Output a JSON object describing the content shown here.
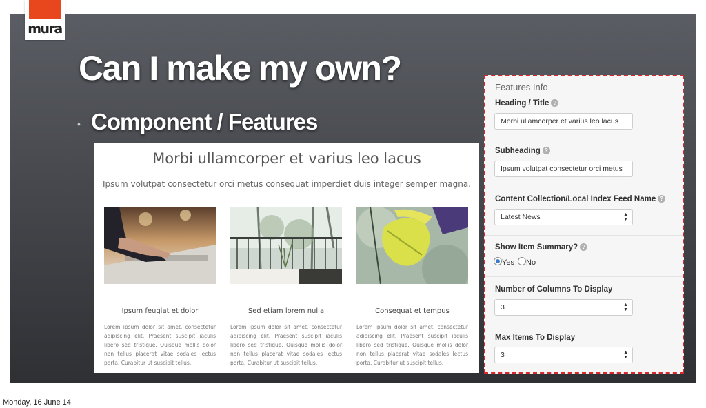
{
  "logo": {
    "text": "mura"
  },
  "slide": {
    "title": "Can I make my own?",
    "bullet_symbol": "•",
    "bullet": "Component / Features"
  },
  "preview": {
    "title": "Morbi ullamcorper et varius leo lacus",
    "subtitle": "Ipsum volutpat consectetur orci metus consequat imperdiet duis integer semper magna.",
    "cards": [
      {
        "title": "Ipsum feugiat et dolor",
        "text": "Lorem ipsum dolor sit amet, consectetur adipiscing elit. Praesent suscipit iaculis libero sed tristique. Quisque mollis dolor non tellus placerat vitae sodales lectus porta. Curabitur ut suscipit tellus."
      },
      {
        "title": "Sed etiam lorem nulla",
        "text": "Lorem ipsum dolor sit amet, consectetur adipiscing elit. Praesent suscipit iaculis libero sed tristique. Quisque mollis dolor non tellus placerat vitae sodales lectus porta. Curabitur ut suscipit tellus."
      },
      {
        "title": "Consequat et tempus",
        "text": "Lorem ipsum dolor sit amet, consectetur adipiscing elit. Praesent suscipit iaculis libero sed tristique. Quisque mollis dolor non tellus placerat vitae sodales lectus porta. Curabitur ut suscipit tellus."
      }
    ]
  },
  "panel": {
    "header": "Features Info",
    "heading_label": "Heading / Title",
    "heading_value": "Morbi ullamcorper et varius leo lacus",
    "subheading_label": "Subheading",
    "subheading_value": "Ipsum volutpat consectetur orci metus",
    "feed_label": "Content Collection/Local Index Feed Name",
    "feed_value": "Latest News",
    "summary_label": "Show Item Summary?",
    "summary_yes": "Yes",
    "summary_no": "No",
    "columns_label": "Number of Columns To Display",
    "columns_value": "3",
    "max_label": "Max Items To Display",
    "max_value": "3",
    "help_glyph": "?"
  },
  "footer": {
    "date": "Monday, 16 June 14"
  },
  "colors": {
    "brand": "#e8471d",
    "highlight": "#d9272e",
    "radio": "#3a7cc7"
  }
}
